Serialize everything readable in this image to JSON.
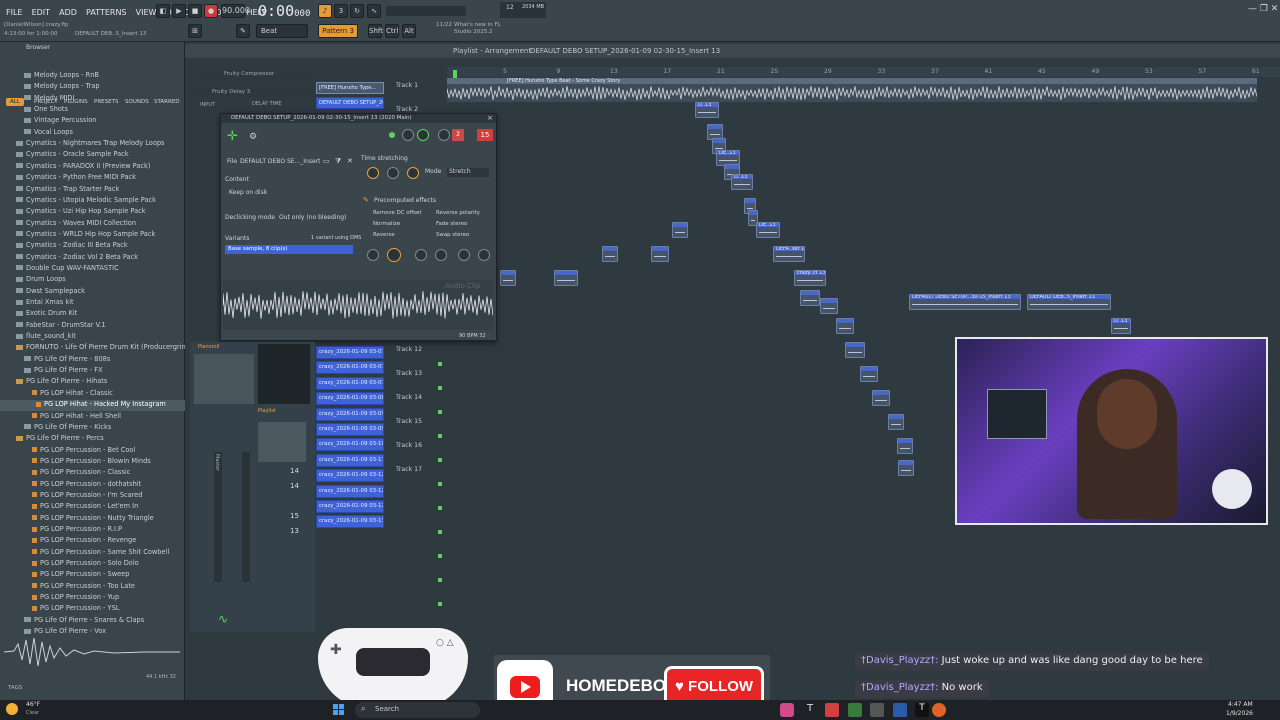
{
  "menu": [
    "FILE",
    "EDIT",
    "ADD",
    "PATTERNS",
    "VIEW",
    "OPTIONS",
    "TOOLS",
    "HELP"
  ],
  "project_hint": "[DanielWilson] crazy.flp",
  "project_time": "4:13:00 for 1:00:00",
  "project_name": "DEFAULT DEB..S_Insert 13",
  "tempo": "90.000",
  "time": "0:00",
  "time_sub": "000",
  "pattern": "Pattern 3",
  "mode": "Beat",
  "snap_tabs": [
    "Shft",
    "Ctrl",
    "Alt"
  ],
  "news": "What's new in FL Studio 2025.2",
  "news_date": "11/22",
  "cpu": "12",
  "ram": "2034 MB",
  "browser": {
    "title": "Browser",
    "tabs": [
      "ALL",
      "PROJECT",
      "PLUGINS",
      "PRESETS",
      "SOUNDS",
      "STARRED"
    ],
    "items": [
      {
        "label": "Melody Loops - RnB",
        "kind": "sub"
      },
      {
        "label": "Melody Loops - Trap",
        "kind": "sub"
      },
      {
        "label": "Melody MIDI",
        "kind": "sub"
      },
      {
        "label": "One Shots",
        "kind": "sub"
      },
      {
        "label": "Vintage Percussion",
        "kind": "sub"
      },
      {
        "label": "Vocal Loops",
        "kind": "sub"
      },
      {
        "label": "Cymatics - Nightmares Trap Melody Loops",
        "kind": "folder"
      },
      {
        "label": "Cymatics - Oracle Sample Pack",
        "kind": "folder"
      },
      {
        "label": "Cymatics - PARADOX II (Preview Pack)",
        "kind": "folder"
      },
      {
        "label": "Cymatics - Python Free MIDI Pack",
        "kind": "folder"
      },
      {
        "label": "Cymatics - Trap Starter Pack",
        "kind": "folder"
      },
      {
        "label": "Cymatics - Utopia Melodic Sample Pack",
        "kind": "folder"
      },
      {
        "label": "Cymatics - Uzi Hip Hop Sample Pack",
        "kind": "folder"
      },
      {
        "label": "Cymatics - Waves MIDI Collection",
        "kind": "folder"
      },
      {
        "label": "Cymatics - WRLD Hip Hop Sample Pack",
        "kind": "folder"
      },
      {
        "label": "Cymatics - Zodiac III Beta Pack",
        "kind": "folder"
      },
      {
        "label": "Cymatics - Zodiac Vol 2 Beta Pack",
        "kind": "folder"
      },
      {
        "label": "Double Cup WAV-FANTASTIC",
        "kind": "folder"
      },
      {
        "label": "Drum Loops",
        "kind": "folder"
      },
      {
        "label": "Dwst Samplepack",
        "kind": "folder"
      },
      {
        "label": "Entai Xmas kit",
        "kind": "folder"
      },
      {
        "label": "Exotic Drum Kit",
        "kind": "folder"
      },
      {
        "label": "FabeStar - DrumStar V.1",
        "kind": "folder"
      },
      {
        "label": "flute_sound_kit",
        "kind": "folder"
      },
      {
        "label": "FORNUTO - Life Of Pierre Drum Kit (Producergrind)",
        "kind": "open"
      },
      {
        "label": "PG Life Of Pierre - 808s",
        "kind": "sub"
      },
      {
        "label": "PG Life Of Pierre - FX",
        "kind": "sub"
      },
      {
        "label": "PG Life Of Pierre - Hihats",
        "kind": "open"
      },
      {
        "label": "PG LOP Hihat - Classic",
        "kind": "file"
      },
      {
        "label": "PG LOP Hihat - Hacked My Instagram",
        "kind": "sel"
      },
      {
        "label": "PG LOP Hihat - Hell Shell",
        "kind": "file"
      },
      {
        "label": "PG Life Of Pierre - Kicks",
        "kind": "sub"
      },
      {
        "label": "PG Life Of Pierre - Percs",
        "kind": "open"
      },
      {
        "label": "PG LOP Percussion - Bet Cool",
        "kind": "file"
      },
      {
        "label": "PG LOP Percussion - Blowin Minds",
        "kind": "file"
      },
      {
        "label": "PG LOP Percussion - Classic",
        "kind": "file"
      },
      {
        "label": "PG LOP Percussion - dothatshit",
        "kind": "file"
      },
      {
        "label": "PG LOP Percussion - I'm Scared",
        "kind": "file"
      },
      {
        "label": "PG LOP Percussion - Let'em In",
        "kind": "file"
      },
      {
        "label": "PG LOP Percussion - Nutty Triangle",
        "kind": "file"
      },
      {
        "label": "PG LOP Percussion - R.I.P",
        "kind": "file"
      },
      {
        "label": "PG LOP Percussion - Revenge",
        "kind": "file"
      },
      {
        "label": "PG LOP Percussion - Same Shit Cowbell",
        "kind": "file"
      },
      {
        "label": "PG LOP Percussion - Solo Dolo",
        "kind": "file"
      },
      {
        "label": "PG LOP Percussion - Sweep",
        "kind": "file"
      },
      {
        "label": "PG LOP Percussion - Too Late",
        "kind": "file"
      },
      {
        "label": "PG LOP Percussion - Yup",
        "kind": "file"
      },
      {
        "label": "PG LOP Percussion - YSL",
        "kind": "file"
      },
      {
        "label": "PG Life Of Pierre - Snares & Claps",
        "kind": "sub"
      },
      {
        "label": "PG Life Of Pierre - Vox",
        "kind": "sub"
      }
    ],
    "preview_info": "44.1 kHz 32",
    "tags_label": "TAGS"
  },
  "playlist": {
    "title": "Playlist - Arrangement",
    "project": "DEFAULT DEBO SETUP_2026-01-09 02-30-15_Insert 13",
    "ruler": [
      "5",
      "9",
      "13",
      "17",
      "21",
      "25",
      "29",
      "33",
      "37",
      "41",
      "45",
      "49",
      "53",
      "57",
      "61"
    ],
    "tracks": [
      "Track 1",
      "Track 2",
      "Track 12",
      "Track 13",
      "Track 14",
      "Track 15",
      "Track 16",
      "Track 17"
    ],
    "top_clip": "[FREE] Hunxho Type Beat - Some Crazy Story",
    "side_clips": [
      "[FREE] Hunxho Type...",
      "DEFAULT DEBO SETUP_202"
    ],
    "patterns": [
      "crazy_2026-01-09 03-07...",
      "crazy_2026-01-09 03-07...",
      "crazy_2026-01-09 03-07...",
      "crazy_2026-01-09 03-08...",
      "crazy_2026-01-09 03-09...",
      "crazy_2026-01-09 03-09...",
      "crazy_2026-01-09 03-10...",
      "crazy_2026-01-09 03-11...",
      "crazy_2026-01-09 03-12...",
      "crazy_2026-01-09 03-12...",
      "crazy_2026-01-09 03-12...",
      "crazy_2026-01-09 03-13..."
    ],
    "clip_labels": [
      "D..13",
      "DE..13",
      "D..13",
      "DE..13",
      "DEFA..set 13",
      "crazy..ct 13",
      "DEFAULT DEBO SETUP...30-15_Insert 13",
      "DEFAULT DEB..5_Insert 13",
      "D..13"
    ]
  },
  "dialog": {
    "title": "DEFAULT DEBO SETUP_2026-01-09 02-30-15_Insert 13 (2020 Main)",
    "file_label": "File",
    "file_value": "DEFAULT DEBO SE..._Insert 13.wav",
    "content_label": "Content",
    "keep_on_disk": "Keep on disk",
    "declicking_label": "Declicking mode",
    "declicking_value": "Out only (no bleeding)",
    "variants_label": "Variants",
    "variants_info": "1 variant using DMS",
    "base_sample": "Base sample, 8 clip(s)",
    "time_stretching": "Time stretching",
    "mode_label": "Mode",
    "mode_value": "Stretch",
    "precomputed": "Precomputed effects",
    "effects_left": [
      "Remove DC offset",
      "Normalize",
      "Reverse"
    ],
    "effects_right": [
      "Reverse polarity",
      "Fade stereo",
      "Swap stereo"
    ],
    "bpm_info": "90 BPM 32",
    "track_num": "15",
    "audio_clip": "Audio Clip"
  },
  "mixer": {
    "numbers": [
      "14",
      "14",
      "15",
      "13"
    ],
    "label": "Master"
  },
  "background_windows": [
    "Fruity Compressor",
    "Fruity Delay 3",
    "DELAY TIME",
    "INPUT"
  ],
  "chat": [
    {
      "user": "†Davis_Playzz†:",
      "text": "Just woke up and was like dang good day to be here"
    },
    {
      "user": "†Davis_Playzz†:",
      "text": "No work"
    }
  ],
  "social": {
    "channel": "HOMEDEBO",
    "follow": "FOLLOW"
  },
  "taskbar": {
    "weather": "46°F",
    "weather_sub": "Clear",
    "search": "Search",
    "time": "4:47 AM",
    "date": "1/9/2026"
  }
}
